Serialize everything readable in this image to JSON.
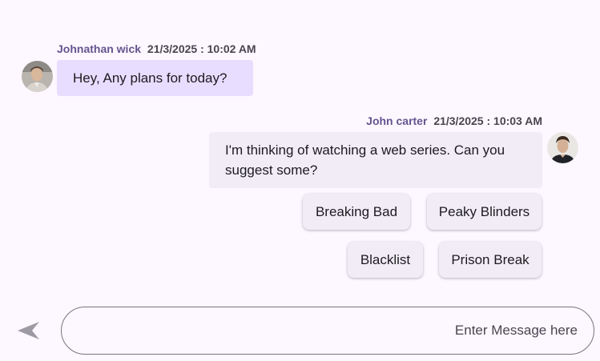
{
  "messages": [
    {
      "sender": "Johnathan wick",
      "timestamp": "21/3/2025 : 10:02 AM",
      "text": "Hey, Any plans for today?",
      "direction": "incoming"
    },
    {
      "sender": "John carter",
      "timestamp": "21/3/2025 : 10:03 AM",
      "text": "I'm thinking of watching a web series. Can you suggest some?",
      "direction": "outgoing"
    }
  ],
  "suggestions": [
    "Breaking Bad",
    "Peaky Blinders",
    "Blacklist",
    "Prison Break"
  ],
  "composer": {
    "placeholder": "Enter Message here",
    "value": ""
  },
  "icons": {
    "send": "send-arrow-icon",
    "avatar_1": "avatar-photo",
    "avatar_2": "avatar-photo"
  },
  "colors": {
    "background": "#fdf7ff",
    "sender_name": "#65558f",
    "incoming_bubble": "#e8ddff",
    "outgoing_bubble": "#f1ecf6",
    "chip": "#f1ecf6",
    "send_icon": "#9e9aa3",
    "input_border": "#79747e"
  }
}
